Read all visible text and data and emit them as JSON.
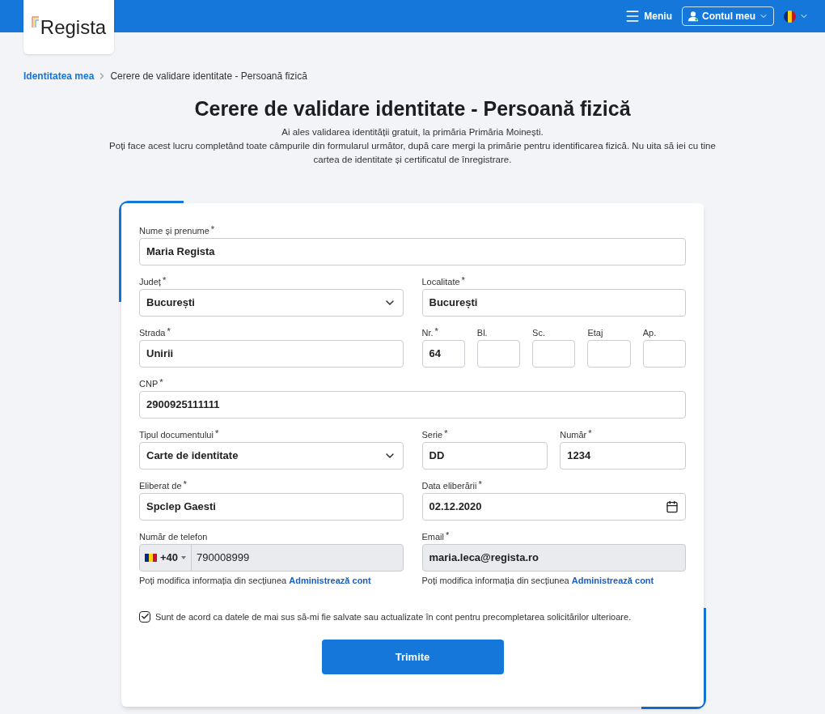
{
  "header": {
    "logo": "Regista",
    "menu": "Meniu",
    "account": "Contul meu"
  },
  "breadcrumb": [
    {
      "label": "Identitatea mea",
      "kind": "link"
    },
    {
      "label": "Cerere de validare identitate - Persoană fizică",
      "kind": "current"
    }
  ],
  "title": "Cerere de validare identitate - Persoană fizică",
  "intro": [
    "Ai ales validarea identității gratuit, la primăria Primăria Moinești.",
    "Poți face acest lucru completând toate câmpurile din formularul următor, după care mergi la primărie pentru identificarea fizică. Nu uita să iei cu tine cartea de identitate și certificatul de înregistrare."
  ],
  "form": {
    "rows": [
      [
        [
          {
            "label": "Nume și prenume",
            "mark": "*",
            "kind": "text",
            "value": "Maria Regista",
            "disabled": false
          }
        ]
      ],
      [
        [
          {
            "label": "Județ",
            "mark": "*",
            "kind": "select",
            "value": "București",
            "disabled": false
          }
        ],
        [
          {
            "label": "Localitate",
            "mark": "*",
            "kind": "text",
            "value": "București",
            "disabled": false
          }
        ]
      ],
      [
        [
          {
            "label": "Strada",
            "mark": "*",
            "kind": "text",
            "value": "Unirii",
            "disabled": false
          }
        ],
        [
          {
            "label": "Nr.",
            "mark": "*",
            "kind": "text",
            "value": "64",
            "disabled": false
          },
          {
            "label": "Bl.",
            "kind": "text",
            "disabled": false
          },
          {
            "label": "Sc.",
            "kind": "text",
            "disabled": false
          },
          {
            "label": "Etaj",
            "kind": "text",
            "disabled": false
          },
          {
            "label": "Ap.",
            "kind": "text",
            "disabled": false
          }
        ]
      ],
      [
        [
          {
            "label": "CNP",
            "mark": "*",
            "kind": "text",
            "value": "2900925111111",
            "disabled": false
          }
        ]
      ],
      [
        [
          {
            "label": "Tipul documentului",
            "mark": "*",
            "kind": "select",
            "value": "Carte de identitate",
            "disabled": false
          }
        ],
        [
          {
            "label": "Serie",
            "mark": "*",
            "kind": "text",
            "value": "DD",
            "disabled": false
          },
          {
            "label": "Număr",
            "mark": "*",
            "kind": "text",
            "value": "1234",
            "disabled": false
          }
        ]
      ],
      [
        [
          {
            "label": "Eliberat de",
            "mark": "*",
            "kind": "text",
            "value": "Spclep Gaesti",
            "disabled": false
          }
        ],
        [
          {
            "label": "Data eliberării",
            "mark": "*",
            "kind": "date",
            "value": "02.12.2020",
            "disabled": false
          }
        ]
      ],
      [
        [
          {
            "label": "Număr de telefon",
            "kind": "phone",
            "code": "+40",
            "value": "790008999",
            "disabled": true,
            "note": "Poți modifica informația din secțiunea",
            "note_link": "Administrează cont"
          }
        ],
        [
          {
            "label": "Email",
            "mark": "*",
            "kind": "text",
            "value": "maria.leca@regista.ro",
            "disabled": true,
            "note": "Poți modifica informația din secțiunea",
            "note_link": "Administrează cont"
          }
        ]
      ]
    ],
    "consent": {
      "checked": true,
      "label": "Sunt de acord ca datele de mai sus să-mi fie salvate sau actualizate în cont pentru precompletarea solicitărilor ulterioare."
    },
    "submit": "Trimite"
  }
}
